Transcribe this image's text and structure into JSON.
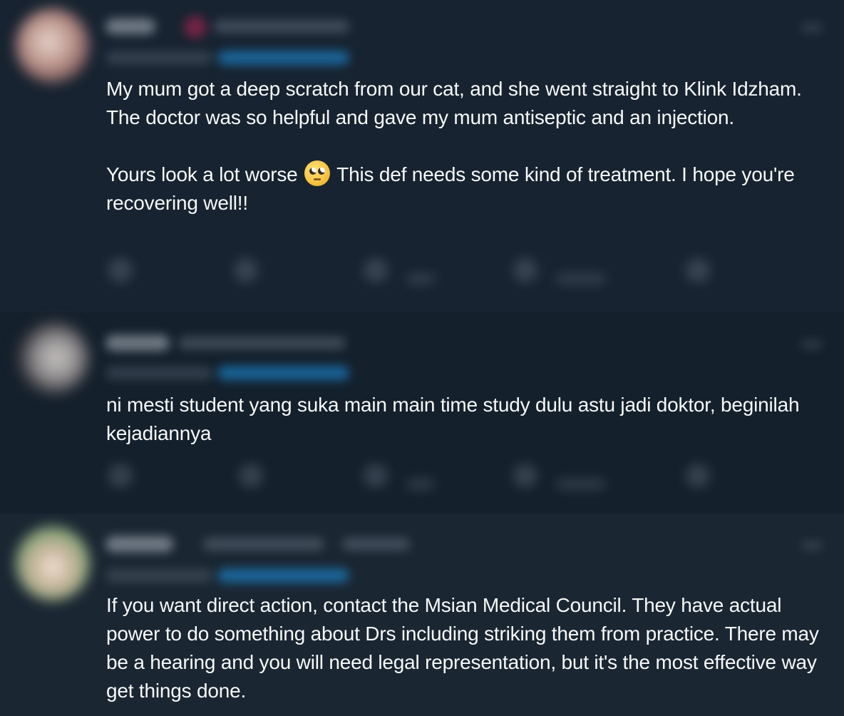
{
  "colors": {
    "background": "#15202b",
    "text": "#f7f9f9",
    "link": "#1d9bf0",
    "muted": "#8b98a5"
  },
  "replies": [
    {
      "paragraphs": [
        "My mum got a deep scratch from our cat, and she went straight to Klink Idzham. The doctor was so helpful and gave my mum antiseptic and an injection.",
        "Yours look a lot worse",
        "This def needs some kind of treatment. I hope you're recovering well!!"
      ],
      "emoji": "face-with-rolling-eyes"
    },
    {
      "paragraphs": [
        "ni mesti student yang suka main main time study dulu astu jadi doktor, beginilah kejadiannya"
      ]
    },
    {
      "paragraphs": [
        "If you want direct action, contact the Msian Medical Council. They have actual power to do something about Drs including striking them from practice. There may be a hearing and you will need legal representation, but it's the most effective way get things done."
      ]
    }
  ],
  "action_icons": [
    "reply-icon",
    "retweet-icon",
    "like-icon",
    "views-icon",
    "share-icon"
  ]
}
